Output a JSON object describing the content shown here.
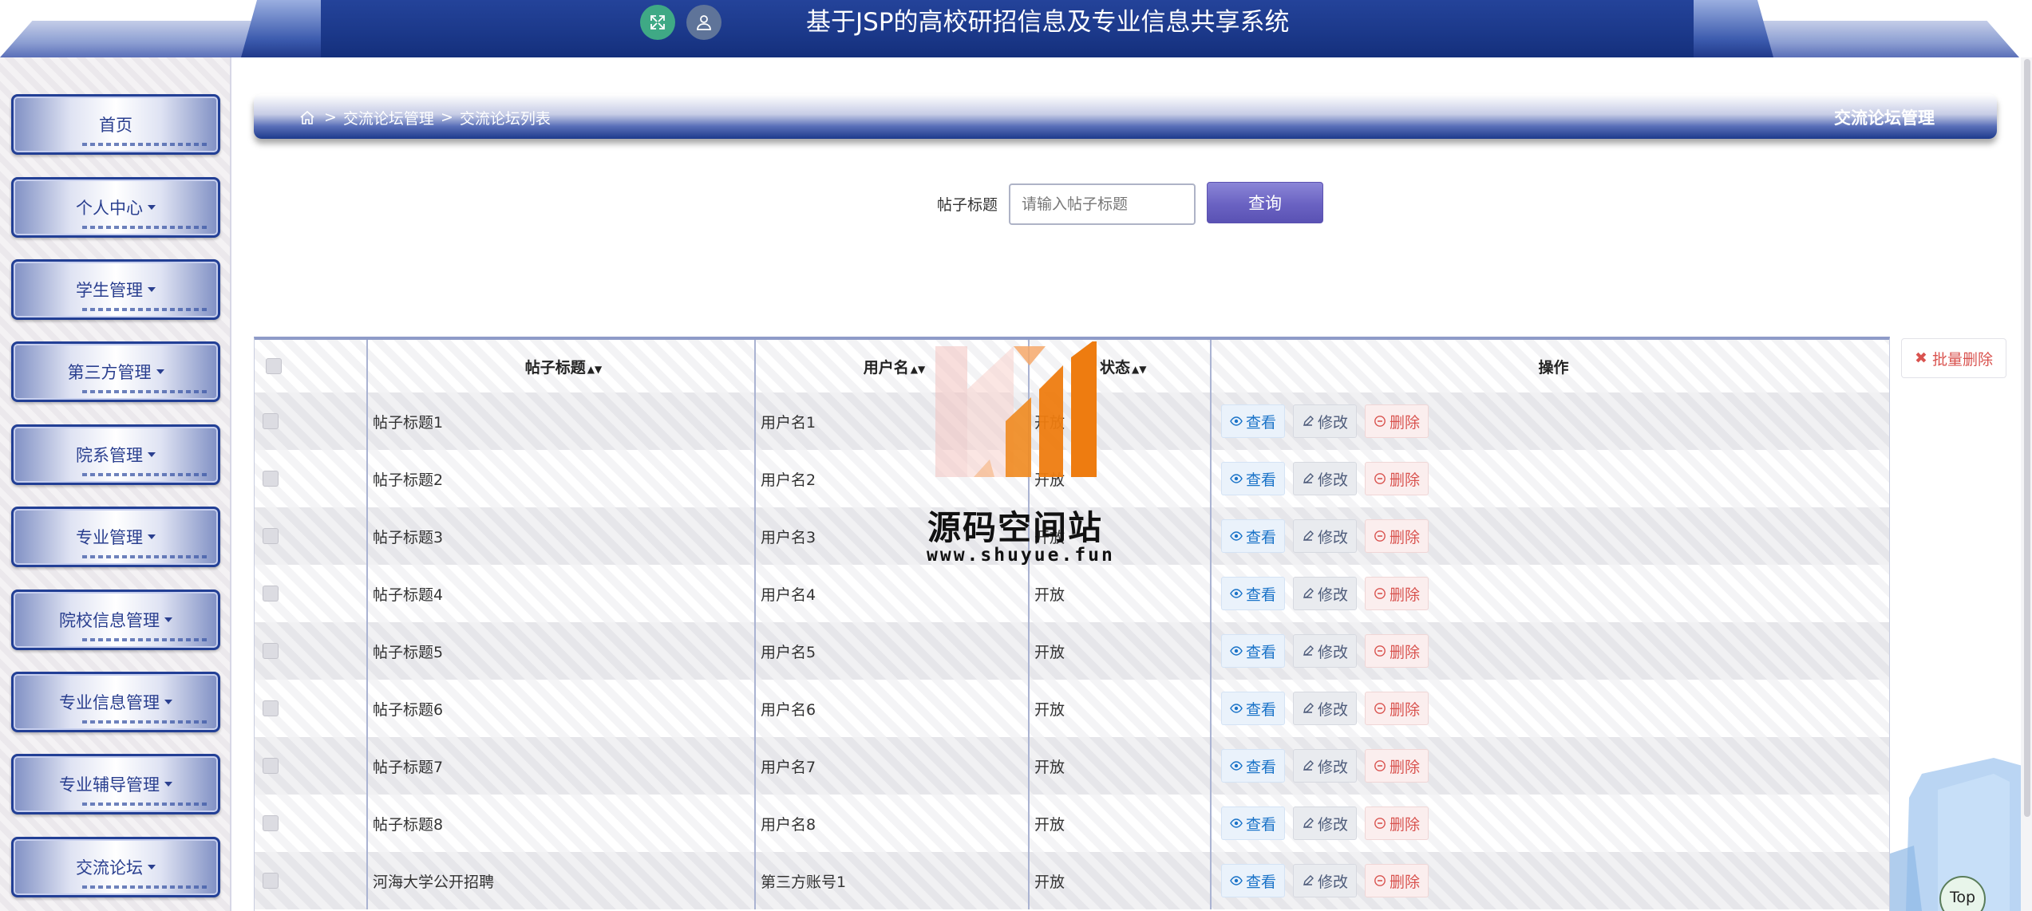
{
  "header": {
    "title": "基于JSP的高校研招信息及专业信息共享系统",
    "expand_icon": "expand-icon",
    "user_icon": "user-icon"
  },
  "sidebar": {
    "items": [
      {
        "label": "首页",
        "has_caret": false
      },
      {
        "label": "个人中心",
        "has_caret": true
      },
      {
        "label": "学生管理",
        "has_caret": true
      },
      {
        "label": "第三方管理",
        "has_caret": true
      },
      {
        "label": "院系管理",
        "has_caret": true
      },
      {
        "label": "专业管理",
        "has_caret": true
      },
      {
        "label": "院校信息管理",
        "has_caret": true
      },
      {
        "label": "专业信息管理",
        "has_caret": true
      },
      {
        "label": "专业辅导管理",
        "has_caret": true
      },
      {
        "label": "交流论坛",
        "has_caret": true
      }
    ]
  },
  "breadcrumb": {
    "sep": ">",
    "level1": "交流论坛管理",
    "level2": "交流论坛列表",
    "right_title": "交流论坛管理"
  },
  "search": {
    "label": "帖子标题",
    "placeholder": "请输入帖子标题",
    "button": "查询"
  },
  "batch_delete": "批量删除",
  "table": {
    "headers": [
      "帖子标题",
      "用户名",
      "状态",
      "操作"
    ],
    "rows": [
      {
        "title": "帖子标题1",
        "user": "用户名1",
        "status": "开放"
      },
      {
        "title": "帖子标题2",
        "user": "用户名2",
        "status": "开放"
      },
      {
        "title": "帖子标题3",
        "user": "用户名3",
        "status": "开放"
      },
      {
        "title": "帖子标题4",
        "user": "用户名4",
        "status": "开放"
      },
      {
        "title": "帖子标题5",
        "user": "用户名5",
        "status": "开放"
      },
      {
        "title": "帖子标题6",
        "user": "用户名6",
        "status": "开放"
      },
      {
        "title": "帖子标题7",
        "user": "用户名7",
        "status": "开放"
      },
      {
        "title": "帖子标题8",
        "user": "用户名8",
        "status": "开放"
      },
      {
        "title": "河海大学公开招聘",
        "user": "第三方账号1",
        "status": "开放"
      }
    ],
    "actions": {
      "view": "查看",
      "edit": "修改",
      "delete": "删除"
    }
  },
  "watermark": {
    "name": "源码空间站",
    "url": "www.shuyue.fun"
  },
  "top_button": "Top",
  "colors": {
    "header_bg": "#1b3889",
    "accent_blue": "#223f95",
    "query_button": "#6a62c2",
    "delete_red": "#d9534f",
    "view_blue": "#1a73c8"
  }
}
